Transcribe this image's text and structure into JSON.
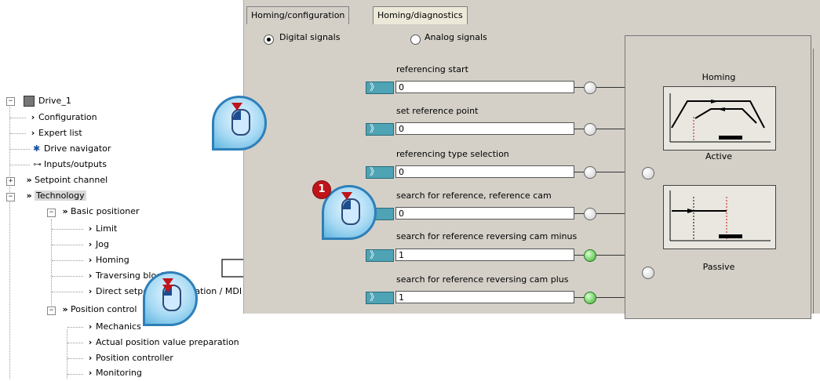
{
  "tree": {
    "root": "Drive_1",
    "items": [
      {
        "label": "Configuration"
      },
      {
        "label": "Expert list"
      },
      {
        "label": "Drive navigator"
      },
      {
        "label": "Inputs/outputs"
      },
      {
        "label": "Setpoint channel"
      },
      {
        "label": "Technology"
      },
      {
        "label": "Basic positioner"
      },
      {
        "label": "Limit"
      },
      {
        "label": "Jog"
      },
      {
        "label": "Homing"
      },
      {
        "label": "Traversing blocks"
      },
      {
        "label": "Direct setpoint specification / MDI"
      },
      {
        "label": "Position control"
      },
      {
        "label": "Mechanics"
      },
      {
        "label": "Actual position value preparation"
      },
      {
        "label": "Position controller"
      },
      {
        "label": "Monitoring"
      }
    ]
  },
  "tabs": [
    {
      "label": "Homing/configuration"
    },
    {
      "label": "Homing/diagnostics"
    }
  ],
  "radios": {
    "digital": "Digital signals",
    "analog": "Analog signals",
    "selected": "digital"
  },
  "signals": [
    {
      "label": "referencing start",
      "value": "0",
      "state": "off"
    },
    {
      "label": "set reference point",
      "value": "0",
      "state": "off"
    },
    {
      "label": "referencing type selection",
      "value": "0",
      "state": "off"
    },
    {
      "label": "search for reference, reference cam",
      "value": "0",
      "state": "off"
    },
    {
      "label": "search for reference reversing cam minus",
      "value": "1",
      "state": "on"
    },
    {
      "label": "search for reference reversing cam plus",
      "value": "1",
      "state": "on"
    }
  ],
  "status": {
    "homing_label": "Homing",
    "active_label": "Active",
    "passive_label": "Passive"
  },
  "callout": {
    "badge": "1"
  },
  "colors": {
    "panel": "#d4d0c8",
    "connector": "#4ea3b5",
    "led_on": "#38b12a",
    "pointer_red": "#c0141b"
  }
}
